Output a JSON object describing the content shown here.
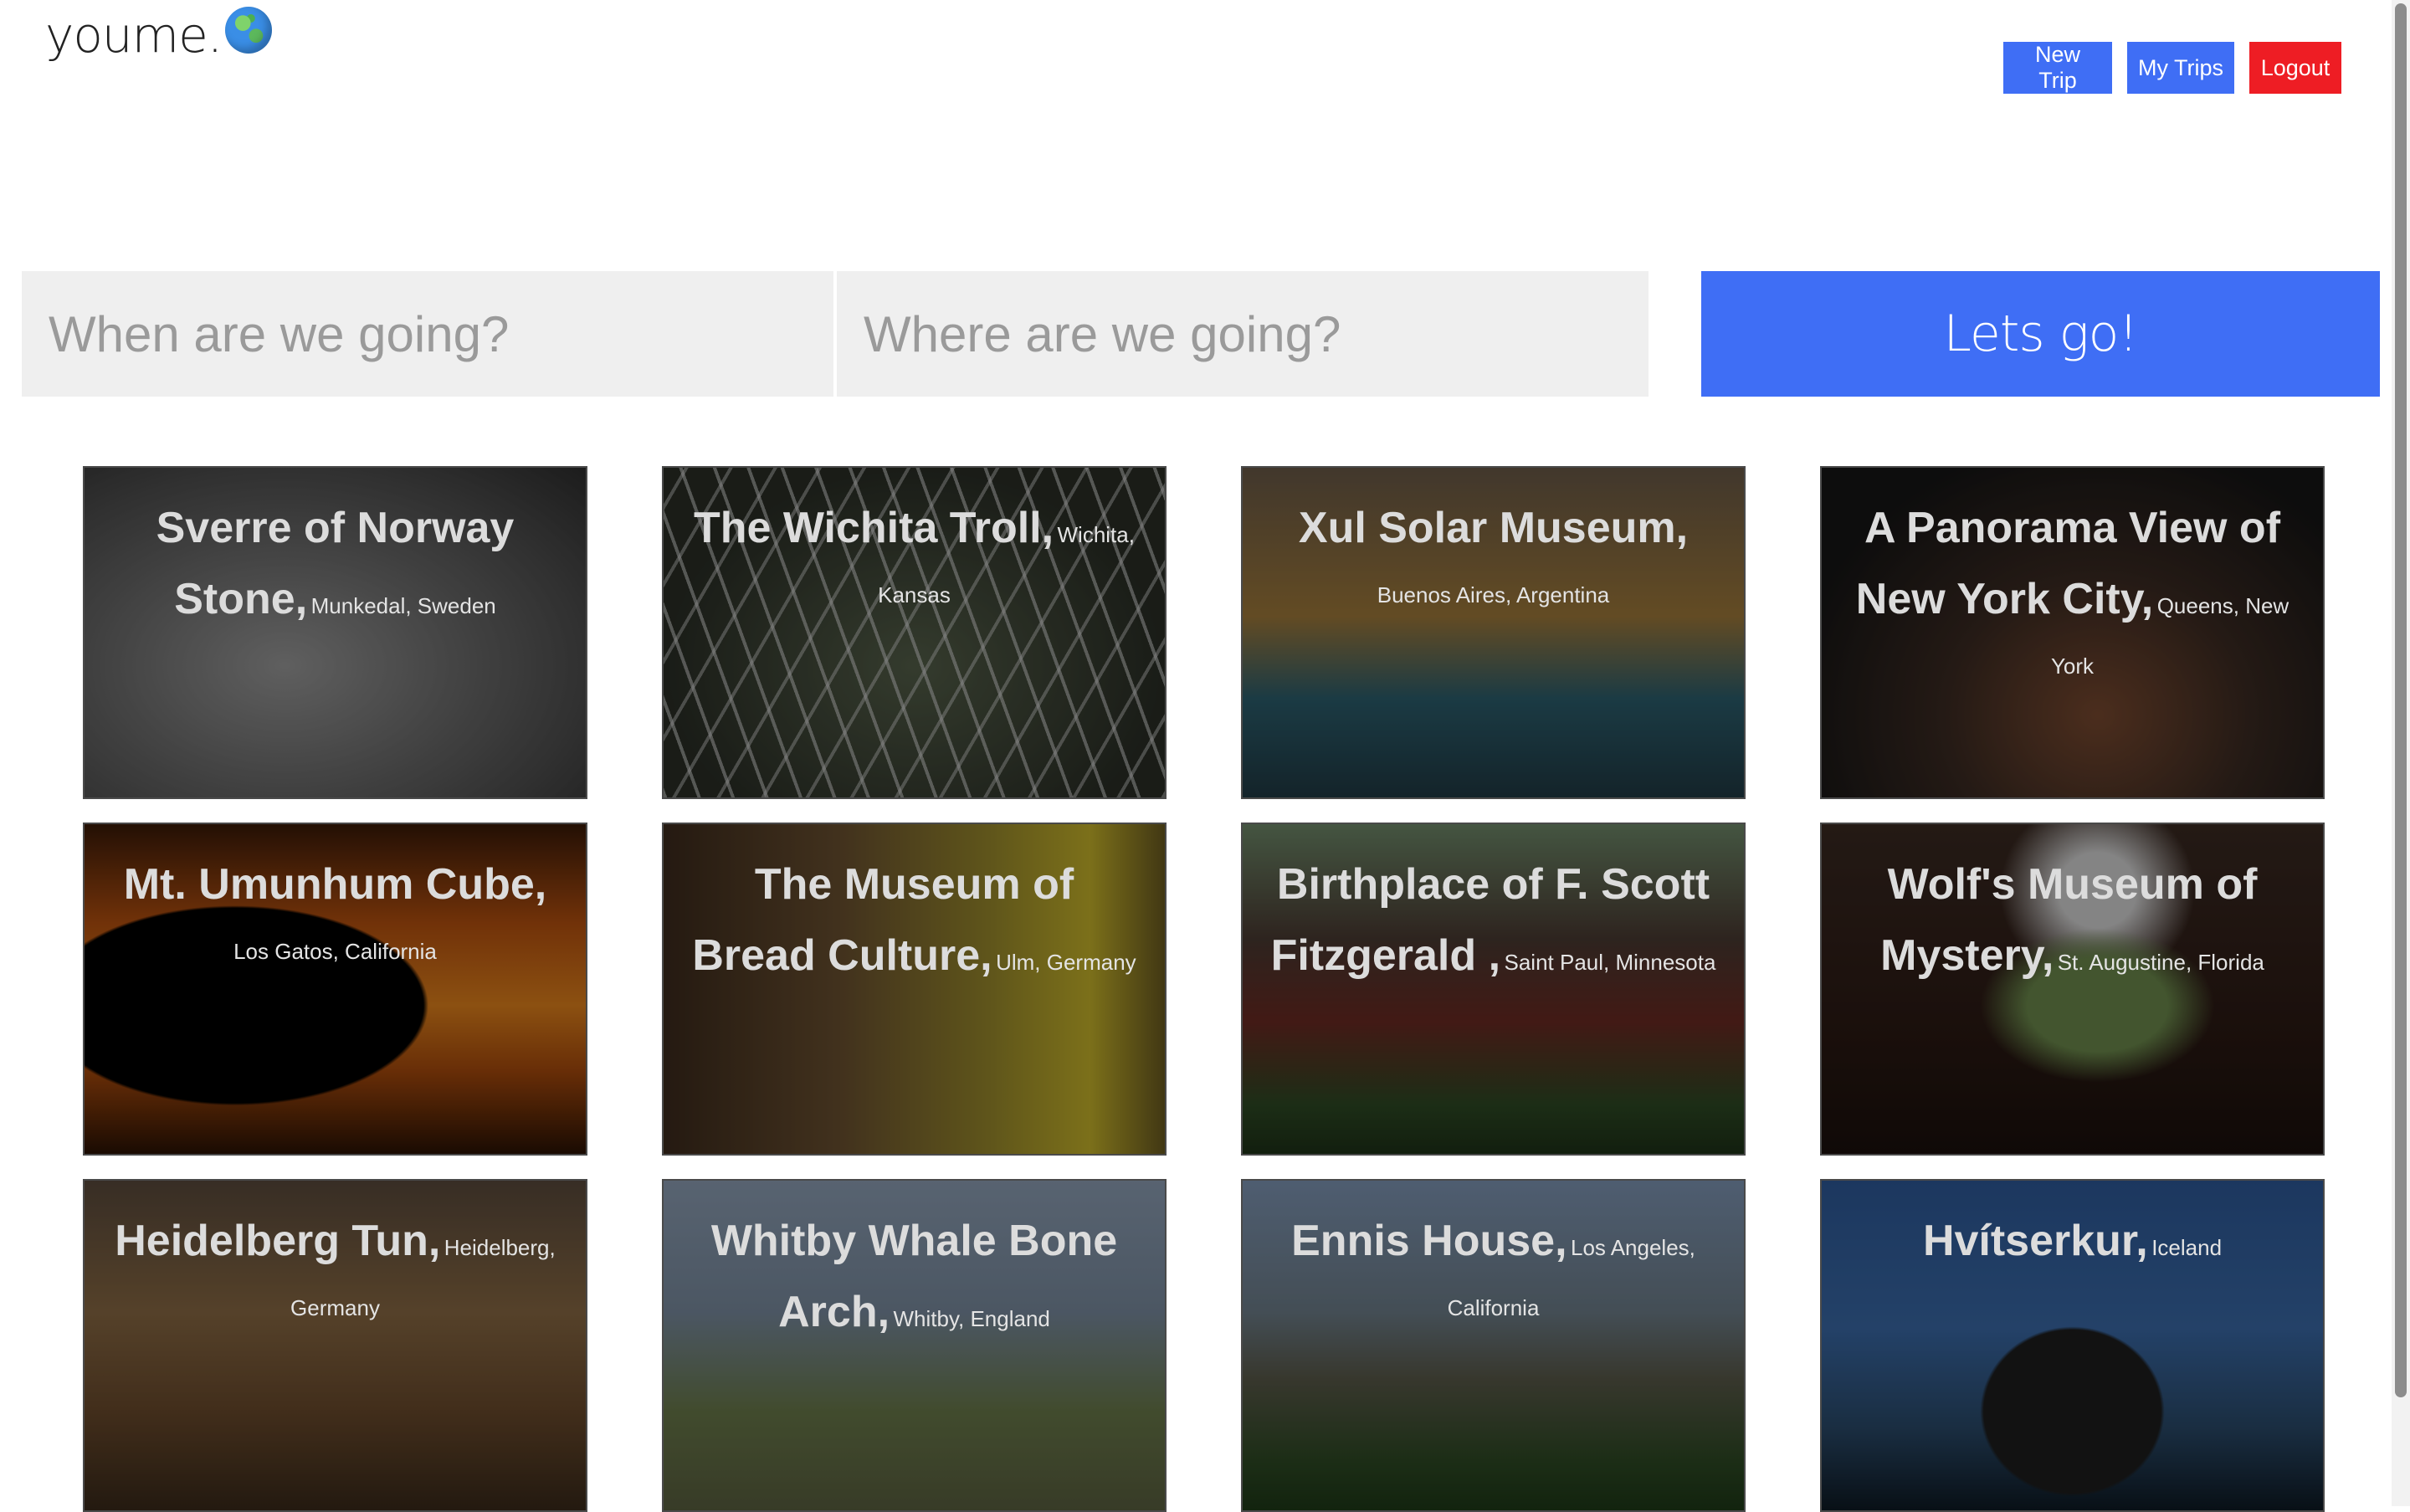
{
  "brand": {
    "name": "youme.",
    "icon": "globe-icon"
  },
  "nav": {
    "new_trip": "New Trip",
    "my_trips": "My Trips",
    "logout": "Logout"
  },
  "search": {
    "when_placeholder": "When are we going?",
    "where_placeholder": "Where are we going?",
    "go_label": "Lets go!"
  },
  "colors": {
    "primary": "#3f6ef5",
    "danger": "#ee1d24",
    "input_bg": "#efefef"
  },
  "cards": [
    {
      "title": "Sverre of Norway Stone,",
      "location": "Munkedal, Sweden"
    },
    {
      "title": "The Wichita Troll,",
      "location": "Wichita, Kansas"
    },
    {
      "title": "Xul Solar Museum,",
      "location": "Buenos Aires, Argentina"
    },
    {
      "title": "A Panorama View of New York City,",
      "location": "Queens, New York"
    },
    {
      "title": "Mt. Umunhum Cube,",
      "location": "Los Gatos, California"
    },
    {
      "title": "The Museum of Bread Culture,",
      "location": "Ulm, Germany"
    },
    {
      "title": "Birthplace of F. Scott Fitzgerald ,",
      "location": "Saint Paul, Minnesota"
    },
    {
      "title": "Wolf's Museum of Mystery,",
      "location": "St. Augustine, Florida"
    },
    {
      "title": "Heidelberg Tun,",
      "location": "Heidelberg, Germany"
    },
    {
      "title": "Whitby Whale Bone Arch,",
      "location": "Whitby, England"
    },
    {
      "title": "Ennis House,",
      "location": "Los Angeles, California"
    },
    {
      "title": "Hvítserkur,",
      "location": "Iceland"
    }
  ]
}
